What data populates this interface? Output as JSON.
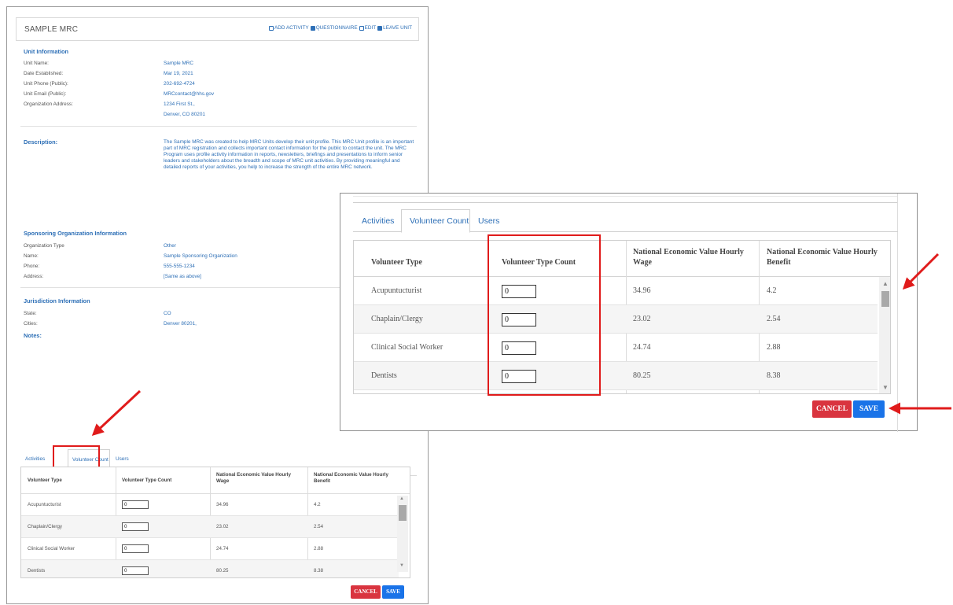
{
  "panel": {
    "title": "SAMPLE MRC",
    "actions": [
      "ADD ACTIVITY",
      "QUESTIONNAIRE",
      "EDIT",
      "LEAVE UNIT"
    ]
  },
  "unit_info": {
    "heading": "Unit Information",
    "rows": [
      {
        "label": "Unit Name:",
        "value": "Sample MRC"
      },
      {
        "label": "Date Established:",
        "value": "Mar 19, 2021"
      },
      {
        "label": "Unit Phone (Public):",
        "value": "202-692-4724"
      },
      {
        "label": "Unit Email (Public):",
        "value": "MRCcontact@hhs.gov"
      },
      {
        "label": "Organization Address:",
        "value": "1234 First St.,"
      },
      {
        "label": "",
        "value": "Denver, CO 80201"
      }
    ]
  },
  "description": {
    "heading": "Description:",
    "text": "The Sample MRC was created to help MRC Units develop their unit profile. This MRC Unit profile is an important part of MRC registration and collects important contact information for the public to contact the unit. The MRC Program uses profile activity information in reports, newsletters, briefings and presentations to inform senior leaders and stakeholders about the breadth and scope of MRC unit activities. By providing meaningful and detailed reports of your activities, you help to increase the strength of the entire MRC network."
  },
  "sponsoring": {
    "heading": "Sponsoring Organization Information",
    "rows": [
      {
        "label": "Organization Type",
        "value": "Other"
      },
      {
        "label": "Name:",
        "value": "Sample Sponsoring Organization"
      },
      {
        "label": "Phone:",
        "value": "555-555-1234"
      },
      {
        "label": "Address:",
        "value": "[Same as above]"
      }
    ]
  },
  "jurisdiction": {
    "heading": "Jurisdiction Information",
    "rows": [
      {
        "label": "State:",
        "value": "CO"
      },
      {
        "label": "Cities:",
        "value": "Denver 80201,"
      }
    ],
    "notes": "Notes:"
  },
  "tabs": [
    "Activities",
    "Volunteer Count",
    "Users"
  ],
  "table": {
    "headers": [
      "Volunteer Type",
      "Volunteer Type Count",
      "National Economic Value Hourly Wage",
      "National Economic Value Hourly Benefit"
    ],
    "rows": [
      {
        "type": "Acupuntucturist",
        "count": "0",
        "wage": "34.96",
        "benefit": "4.2"
      },
      {
        "type": "Chaplain/Clergy",
        "count": "0",
        "wage": "23.02",
        "benefit": "2.54"
      },
      {
        "type": "Clinical Social Worker",
        "count": "0",
        "wage": "24.74",
        "benefit": "2.88"
      },
      {
        "type": "Dentists",
        "count": "0",
        "wage": "80.25",
        "benefit": "8.38"
      }
    ]
  },
  "buttons": {
    "cancel": "CANCEL",
    "save": "SAVE"
  },
  "colors": {
    "link": "#2d6fb6",
    "cancel": "#d9343f",
    "save": "#1a73e8",
    "annotation": "#e01b1b"
  }
}
